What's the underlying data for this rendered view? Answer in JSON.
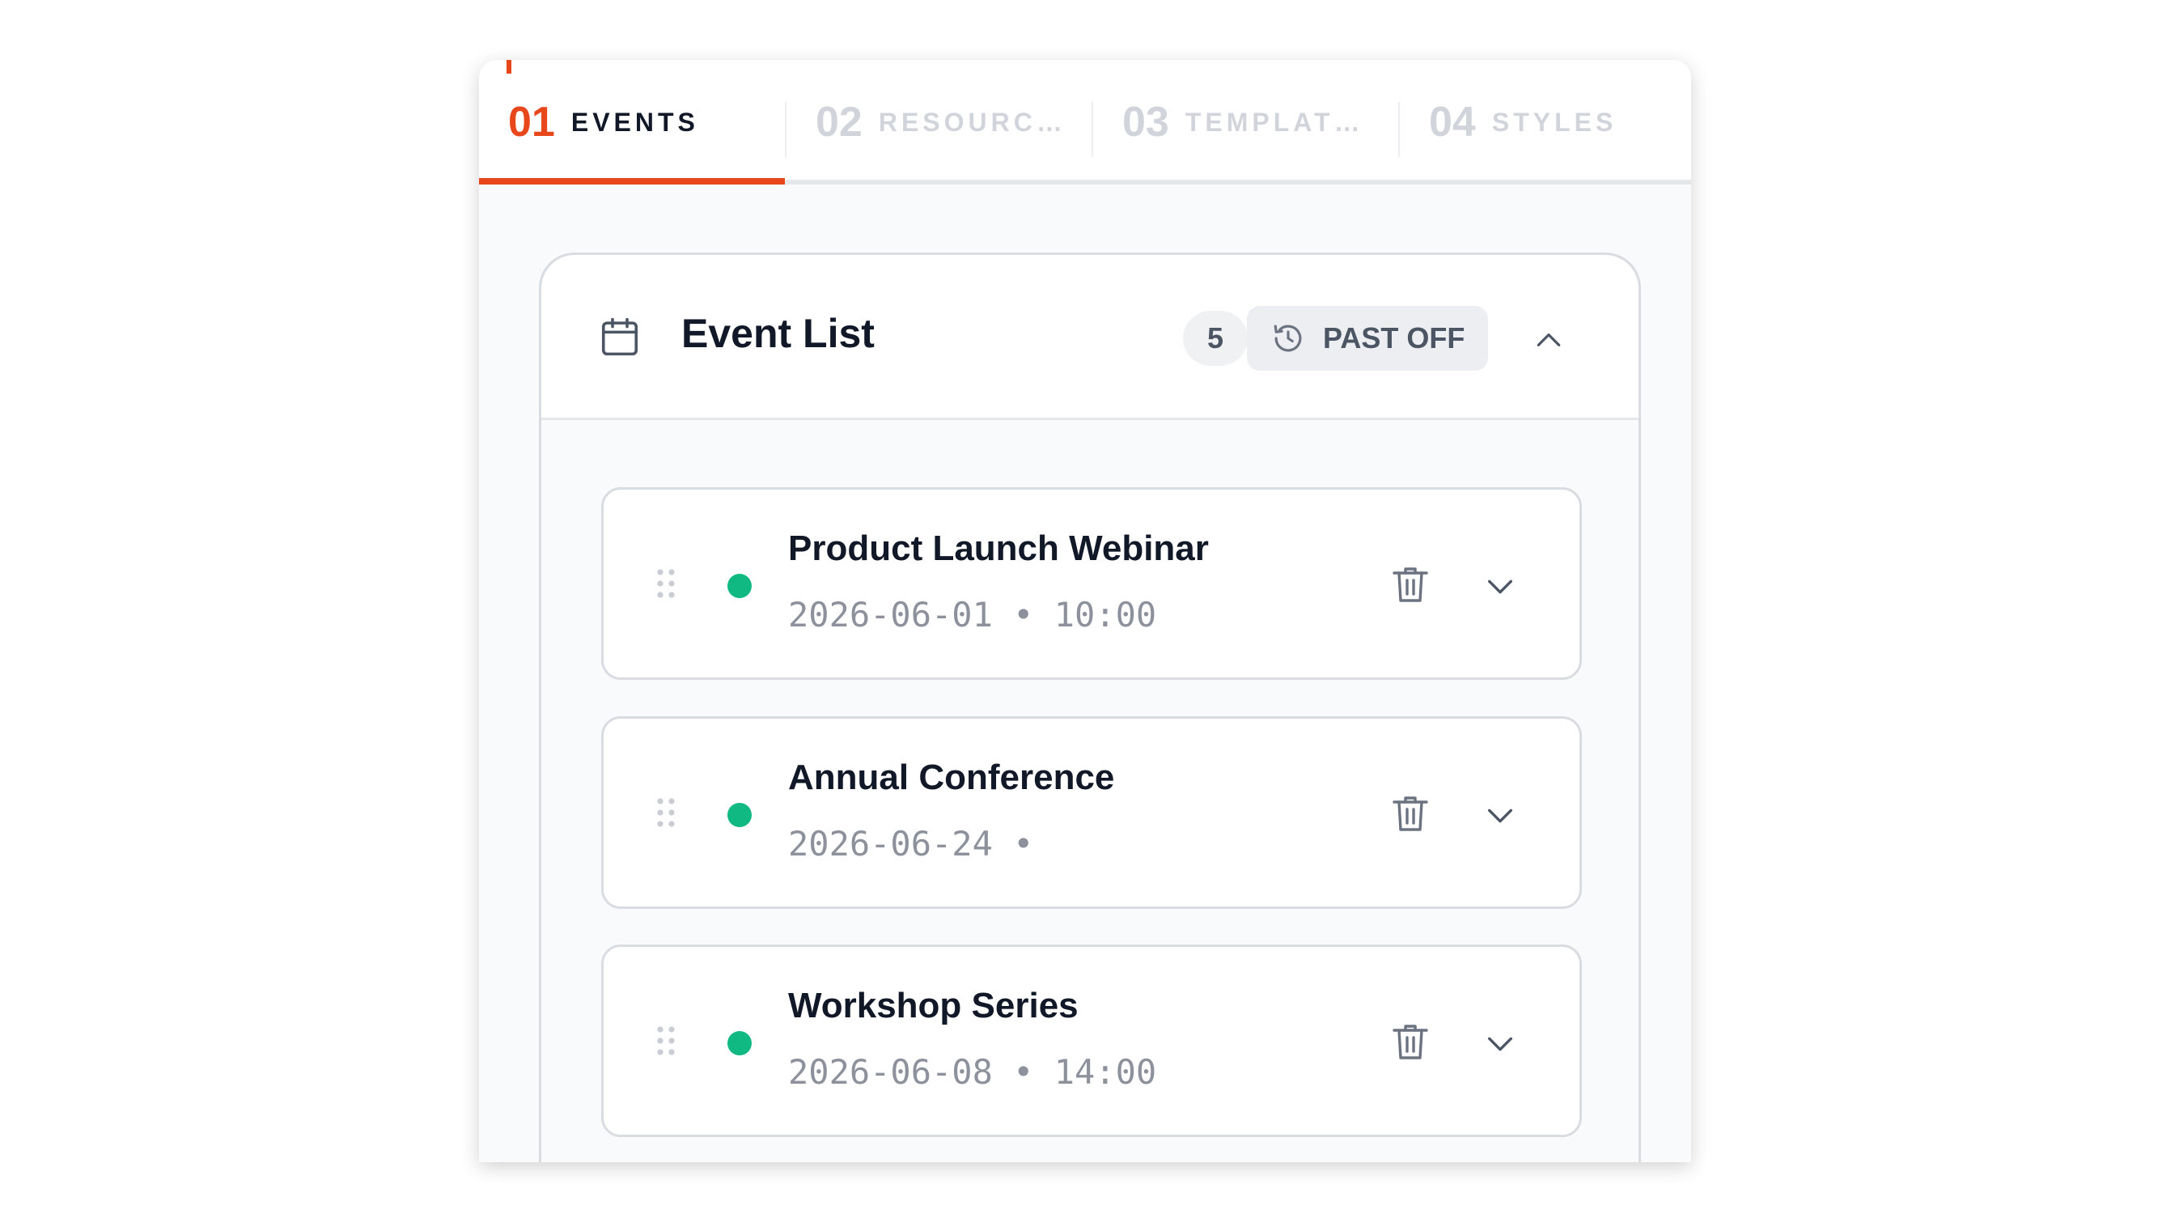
{
  "tabs": [
    {
      "number": "01",
      "label": "EVENTS",
      "active": true
    },
    {
      "number": "02",
      "label": "RESOURC…",
      "active": false
    },
    {
      "number": "03",
      "label": "TEMPLAT…",
      "active": false
    },
    {
      "number": "04",
      "label": "STYLES",
      "active": false
    }
  ],
  "event_list": {
    "title": "Event List",
    "count": "5",
    "past_toggle_label": "PAST OFF",
    "icons": {
      "header": "calendar-icon",
      "toggle": "history-icon",
      "collapse": "chevron-up-icon"
    }
  },
  "events": [
    {
      "name": "Product Launch Webinar",
      "datetime": "2026-06-01 • 10:00",
      "status_color": "#10b981"
    },
    {
      "name": "Annual Conference",
      "datetime": "2026-06-24 •",
      "status_color": "#10b981"
    },
    {
      "name": "Workshop Series",
      "datetime": "2026-06-08 • 14:00",
      "status_color": "#10b981"
    }
  ],
  "event_icons": {
    "drag": "drag-handle-icon",
    "delete": "trash-icon",
    "expand": "chevron-down-icon"
  },
  "colors": {
    "accent": "#e8471c",
    "status_active": "#10b981",
    "inactive_tab": "#d1d5db"
  }
}
